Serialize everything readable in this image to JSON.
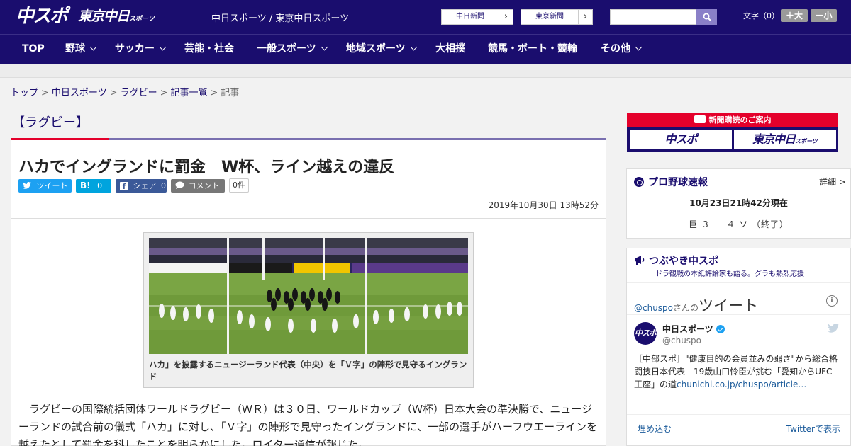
{
  "header": {
    "logo_chuspo": "中スポ",
    "logo_tokyo": "東京中日",
    "logo_tokyo_small": "スポーツ",
    "site_name": "中日スポーツ / 東京中日スポーツ",
    "ext_links": [
      "中日新聞",
      "東京新聞"
    ],
    "search_placeholder": "",
    "font_label": "文字（0）",
    "font_large": "＋大",
    "font_small": "－小"
  },
  "nav": {
    "items": [
      {
        "label": "TOP",
        "dropdown": false
      },
      {
        "label": "野球",
        "dropdown": true
      },
      {
        "label": "サッカー",
        "dropdown": true
      },
      {
        "label": "芸能・社会",
        "dropdown": false
      },
      {
        "label": "一般スポーツ",
        "dropdown": true
      },
      {
        "label": "地域スポーツ",
        "dropdown": true
      },
      {
        "label": "大相撲",
        "dropdown": false
      },
      {
        "label": "競馬・ボート・競輪",
        "dropdown": false
      },
      {
        "label": "その他",
        "dropdown": true
      }
    ]
  },
  "breadcrumb": {
    "items": [
      "トップ",
      "中日スポーツ",
      "ラグビー",
      "記事一覧"
    ],
    "current": "記事",
    "separator": ">"
  },
  "article": {
    "category": "【ラグビー】",
    "headline": "ハカでイングランドに罰金　W杯、ライン越えの違反",
    "share": {
      "tweet": "ツイート",
      "hatena_icon": "B!",
      "hatena_count": "0",
      "facebook": "シェア",
      "facebook_count": "0",
      "comment": "コメント",
      "comment_count": "0件"
    },
    "date": "2019年10月30日 13時52分",
    "photo_caption": "ハカ」を披露するニュージーランド代表（中央）を「Ｖ字」の陣形で見守るイングランド",
    "body": "ラグビーの国際統括団体ワールドラグビー（ＷＲ）は３０日、ワールドカップ（Ｗ杯）日本大会の準決勝で、ニュージーランドの試合前の儀式「ハカ」に対し、「Ｖ字」の陣形で見守ったイングランドに、一部の選手がハーフウエーラインを越えたとして罰金を科したことを明らかにした。ロイター通信が報じた。"
  },
  "sidebar": {
    "subscription": {
      "title": "新聞購読のご案内",
      "chuspo": "中スポ",
      "tokyo": "東京中日",
      "tokyo_small": "スポーツ"
    },
    "baseball": {
      "title": "プロ野球速報",
      "more": "詳細 >",
      "as_of": "10月23日21時42分現在",
      "score": "巨 ３ － ４ ソ （終了）"
    },
    "twitter": {
      "title": "つぶやき中スポ",
      "subtitle": "ドラ観戦の本紙評論家も語る。グラも熱烈応援",
      "handle": "@chuspo",
      "handle_suffix": "さんの",
      "tweets_label": "ツイート",
      "account_name": "中日スポーツ",
      "account_id": "@chuspo",
      "avatar_text": "中スポ",
      "tweet_text": "［中部スポ］\"健康目的の会員並みの弱さ\"から総合格闘技日本代表　19歳山口怜臣が挑む「愛知からUFC王座」の道",
      "tweet_link": "chunichi.co.jp/chuspo/article…",
      "embed": "埋め込む",
      "view_on": "Twitterで表示"
    }
  },
  "colors": {
    "brand_navy": "#1a0d6e",
    "accent_red": "#e4002b",
    "twitter_blue": "#1da1f2",
    "facebook_blue": "#3b5998",
    "hatena_blue": "#00a4de"
  }
}
